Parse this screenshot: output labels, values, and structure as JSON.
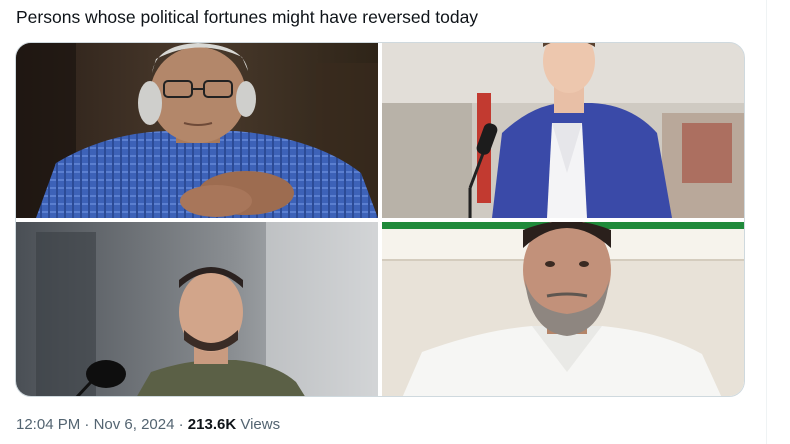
{
  "tweet": {
    "text": "Persons whose political fortunes might have reversed today",
    "time": "12:04 PM",
    "separator": "·",
    "date": "Nov 6, 2024",
    "views_count": "213.6K",
    "views_label": "Views"
  },
  "media": {
    "photos": [
      {
        "subject": "elderly man in blue checked kurta with clasped hands",
        "icon": "photo"
      },
      {
        "subject": "man in blue suit at microphone",
        "icon": "photo"
      },
      {
        "subject": "man in olive t-shirt at microphone",
        "icon": "photo"
      },
      {
        "subject": "bearded man in white polo",
        "icon": "photo"
      }
    ]
  },
  "colors": {
    "text": "#0f1419",
    "secondary": "#536471",
    "border": "#cfd9de"
  }
}
